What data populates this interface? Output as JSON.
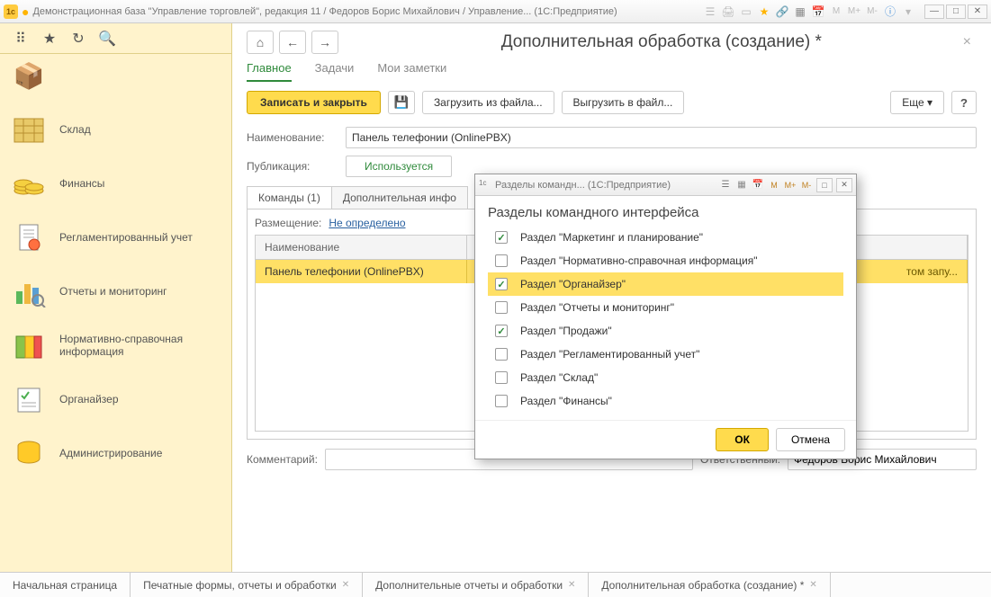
{
  "window": {
    "title": "Демонстрационная база \"Управление торговлей\", редакция 11 / Федоров Борис Михайлович / Управление... (1С:Предприятие)",
    "calc_labels": [
      "M",
      "M+",
      "M-"
    ]
  },
  "sidebar": {
    "items": [
      {
        "label": "Склад"
      },
      {
        "label": "Финансы"
      },
      {
        "label": "Регламентированный учет"
      },
      {
        "label": "Отчеты и мониторинг"
      },
      {
        "label": "Нормативно-справочная информация"
      },
      {
        "label": "Органайзер"
      },
      {
        "label": "Администрирование"
      }
    ]
  },
  "page": {
    "title": "Дополнительная обработка (создание) *",
    "tabs": [
      "Главное",
      "Задачи",
      "Мои заметки"
    ],
    "toolbar": {
      "save_close": "Записать и закрыть",
      "load_file": "Загрузить из файла...",
      "export_file": "Выгрузить в файл...",
      "more": "Еще"
    },
    "fields": {
      "name_label": "Наименование:",
      "name_value": "Панель телефонии (OnlinePBX)",
      "pub_label": "Публикация:",
      "pub_value": "Используется"
    },
    "subtabs": [
      "Команды (1)",
      "Дополнительная инфо"
    ],
    "placement": {
      "label": "Размещение:",
      "link": "Не определено"
    },
    "grid": {
      "col_name": "Наименование",
      "row_name": "Панель телефонии (OnlinePBX)",
      "row_rest": "том запу..."
    },
    "footer": {
      "comment_label": "Комментарий:",
      "comment_value": "",
      "resp_label": "Ответственный:",
      "resp_value": "Федоров Борис Михайлович"
    }
  },
  "bottom_tabs": [
    "Начальная страница",
    "Печатные формы, отчеты и обработки",
    "Дополнительные отчеты и обработки",
    "Дополнительная обработка (создание) *"
  ],
  "modal": {
    "title": "Разделы командн... (1С:Предприятие)",
    "heading": "Разделы командного интерфейса",
    "items": [
      {
        "label": "Раздел \"Маркетинг и планирование\"",
        "checked": true
      },
      {
        "label": "Раздел \"Нормативно-справочная информация\"",
        "checked": false
      },
      {
        "label": "Раздел \"Органайзер\"",
        "checked": true,
        "selected": true
      },
      {
        "label": "Раздел \"Отчеты и мониторинг\"",
        "checked": false
      },
      {
        "label": "Раздел \"Продажи\"",
        "checked": true
      },
      {
        "label": "Раздел \"Регламентированный учет\"",
        "checked": false
      },
      {
        "label": "Раздел \"Склад\"",
        "checked": false
      },
      {
        "label": "Раздел \"Финансы\"",
        "checked": false
      }
    ],
    "ok": "ОК",
    "cancel": "Отмена",
    "calc_labels": [
      "M",
      "M+",
      "M-"
    ]
  }
}
